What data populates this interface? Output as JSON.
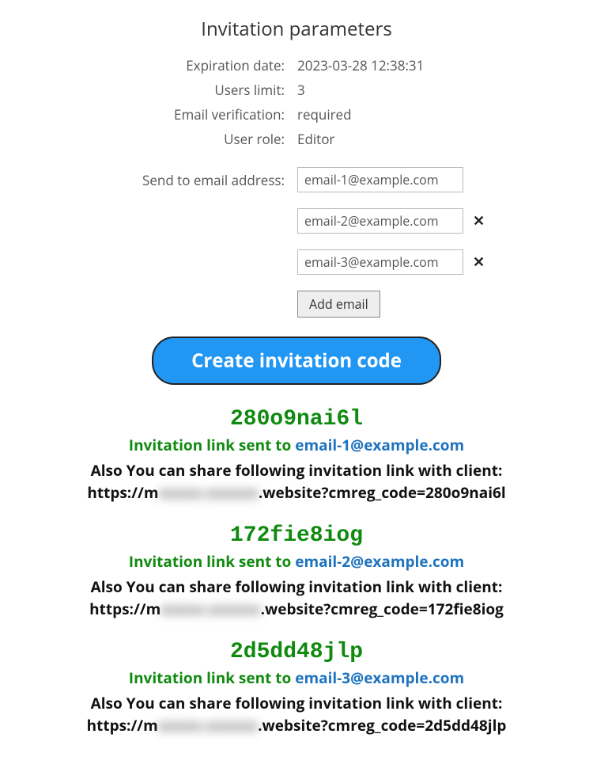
{
  "title": "Invitation parameters",
  "params": {
    "expiration_label": "Expiration date:",
    "expiration_value": "2023-03-28 12:38:31",
    "users_limit_label": "Users limit:",
    "users_limit_value": "3",
    "email_verif_label": "Email verification:",
    "email_verif_value": "required",
    "user_role_label": "User role:",
    "user_role_value": "Editor"
  },
  "email_section": {
    "send_label": "Send to email address:",
    "emails": [
      {
        "value": "email-1@example.com",
        "removable": false
      },
      {
        "value": "email-2@example.com",
        "removable": true
      },
      {
        "value": "email-3@example.com",
        "removable": true
      }
    ],
    "remove_symbol": "✕",
    "add_button": "Add email"
  },
  "create_button": "Create invitation code",
  "results": [
    {
      "code": "280o9nai6l",
      "sent_prefix": "Invitation link sent to ",
      "sent_email": "email-1@example.com",
      "share_text": "Also You can share following invitation link with client:",
      "link_prefix": "https://m",
      "link_blurred": "xxxxx.xxxxxx",
      "link_suffix": ".website?cmreg_code=280o9nai6l"
    },
    {
      "code": "172fie8iog",
      "sent_prefix": "Invitation link sent to ",
      "sent_email": "email-2@example.com",
      "share_text": "Also You can share following invitation link with client:",
      "link_prefix": "https://m",
      "link_blurred": "xxxxx.xxxxxx",
      "link_suffix": ".website?cmreg_code=172fie8iog"
    },
    {
      "code": "2d5dd48jlp",
      "sent_prefix": "Invitation link sent to ",
      "sent_email": "email-3@example.com",
      "share_text": "Also You can share following invitation link with client:",
      "link_prefix": "https://m",
      "link_blurred": "xxxxx.xxxxxx",
      "link_suffix": ".website?cmreg_code=2d5dd48jlp"
    }
  ]
}
